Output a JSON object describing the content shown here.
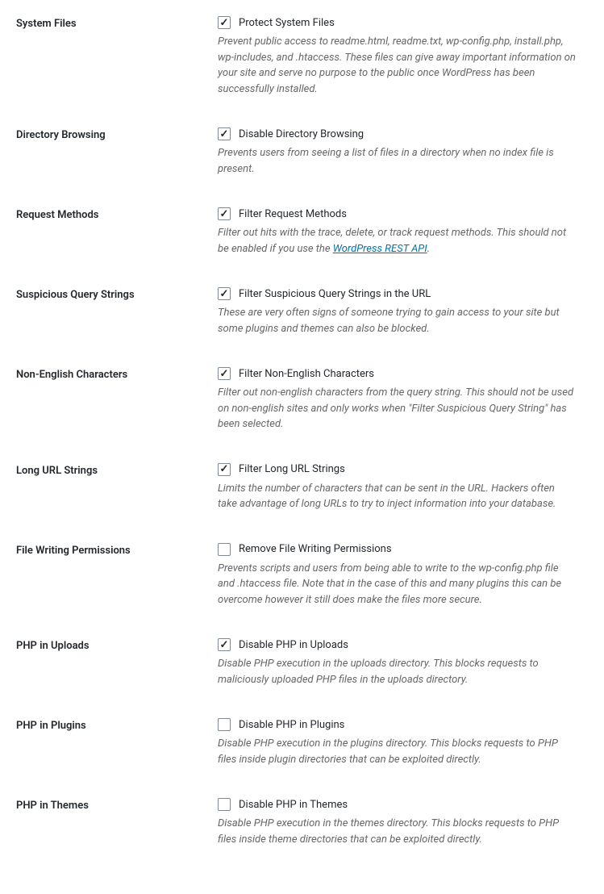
{
  "settings": [
    {
      "label": "System Files",
      "checked": true,
      "checkbox_label": "Protect System Files",
      "description": "Prevent public access to readme.html, readme.txt, wp-config.php, install.php, wp-includes, and .htaccess. These files can give away important information on your site and serve no purpose to the public once WordPress has been successfully installed."
    },
    {
      "label": "Directory Browsing",
      "checked": true,
      "checkbox_label": "Disable Directory Browsing",
      "description": "Prevents users from seeing a list of files in a directory when no index file is present."
    },
    {
      "label": "Request Methods",
      "checked": true,
      "checkbox_label": "Filter Request Methods",
      "description_pre": "Filter out hits with the trace, delete, or track request methods. This should not be enabled if you use the ",
      "link_text": "WordPress REST API",
      "description_post": "."
    },
    {
      "label": "Suspicious Query Strings",
      "checked": true,
      "checkbox_label": "Filter Suspicious Query Strings in the URL",
      "description": "These are very often signs of someone trying to gain access to your site but some plugins and themes can also be blocked."
    },
    {
      "label": "Non-English Characters",
      "checked": true,
      "checkbox_label": "Filter Non-English Characters",
      "description": "Filter out non-english characters from the query string. This should not be used on non-english sites and only works when \"Filter Suspicious Query String\" has been selected."
    },
    {
      "label": "Long URL Strings",
      "checked": true,
      "checkbox_label": "Filter Long URL Strings",
      "description": "Limits the number of characters that can be sent in the URL. Hackers often take advantage of long URLs to try to inject information into your database."
    },
    {
      "label": "File Writing Permissions",
      "checked": false,
      "checkbox_label": "Remove File Writing Permissions",
      "description": "Prevents scripts and users from being able to write to the wp-config.php file and .htaccess file. Note that in the case of this and many plugins this can be overcome however it still does make the files more secure."
    },
    {
      "label": "PHP in Uploads",
      "checked": true,
      "checkbox_label": "Disable PHP in Uploads",
      "description": "Disable PHP execution in the uploads directory. This blocks requests to maliciously uploaded PHP files in the uploads directory."
    },
    {
      "label": "PHP in Plugins",
      "checked": false,
      "checkbox_label": "Disable PHP in Plugins",
      "description": "Disable PHP execution in the plugins directory. This blocks requests to PHP files inside plugin directories that can be exploited directly."
    },
    {
      "label": "PHP in Themes",
      "checked": false,
      "checkbox_label": "Disable PHP in Themes",
      "description": "Disable PHP execution in the themes directory. This blocks requests to PHP files inside theme directories that can be exploited directly."
    }
  ]
}
